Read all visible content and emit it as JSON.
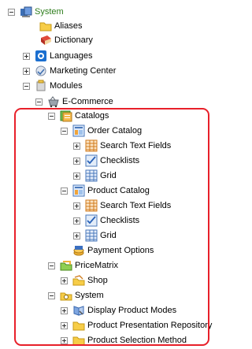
{
  "tree": {
    "system_root": "System",
    "aliases": "Aliases",
    "dictionary": "Dictionary",
    "languages": "Languages",
    "marketing_center": "Marketing Center",
    "modules": "Modules",
    "ecommerce": "E-Commerce",
    "catalogs": "Catalogs",
    "order_catalog": "Order Catalog",
    "order_search_text_fields": "Search Text Fields",
    "order_checklists": "Checklists",
    "order_grid": "Grid",
    "product_catalog": "Product Catalog",
    "product_search_text_fields": "Search Text Fields",
    "product_checklists": "Checklists",
    "product_grid": "Grid",
    "payment_options": "Payment Options",
    "price_matrix": "PriceMatrix",
    "shop": "Shop",
    "system_sub": "System",
    "display_product_modes": "Display Product Modes",
    "product_presentation_repository": "Product Presentation Repository",
    "product_selection_method": "Product Selection Method"
  },
  "colors": {
    "highlight_border": "#e8202a",
    "root_label": "#2e7d1c"
  }
}
